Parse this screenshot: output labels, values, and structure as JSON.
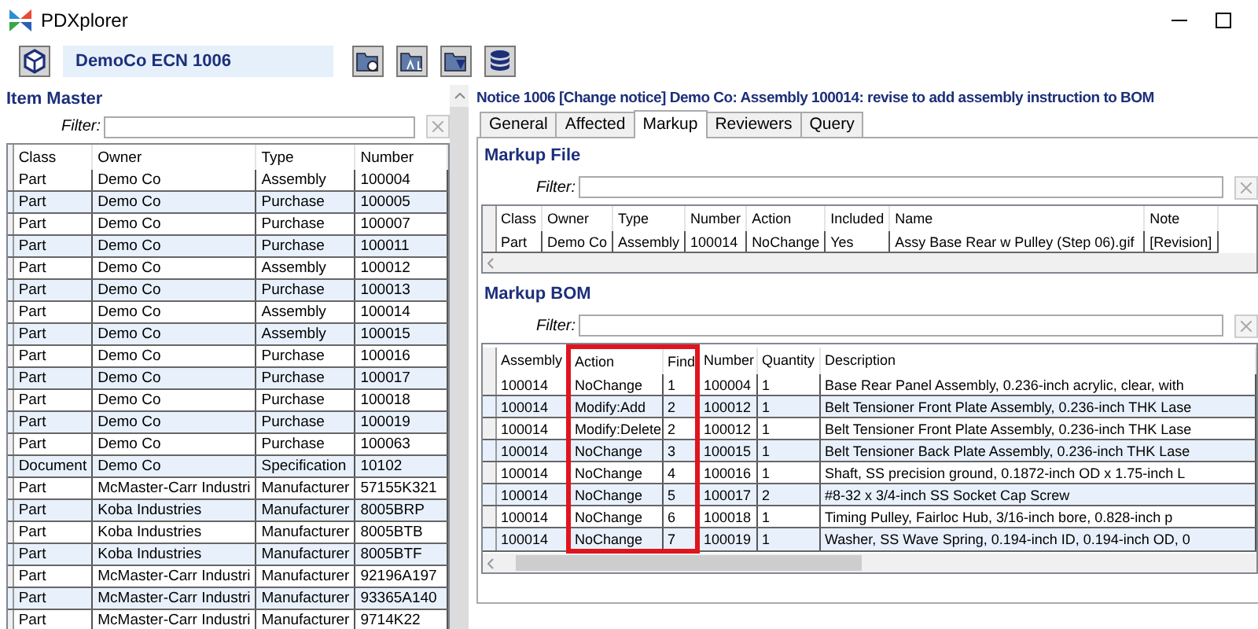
{
  "window": {
    "title": "PDXplorer"
  },
  "toolbar": {
    "context": "DemoCo ECN 1006"
  },
  "item_master": {
    "title": "Item Master",
    "filter": {
      "label": "Filter:"
    },
    "table": {
      "columns": [
        {
          "label": "Class"
        },
        {
          "label": "Owner"
        },
        {
          "label": "Type"
        },
        {
          "label": "Number"
        }
      ],
      "rows": [
        [
          "Part",
          "Demo Co",
          "Assembly",
          "100004"
        ],
        [
          "Part",
          "Demo Co",
          "Purchase",
          "100005"
        ],
        [
          "Part",
          "Demo Co",
          "Purchase",
          "100007"
        ],
        [
          "Part",
          "Demo Co",
          "Purchase",
          "100011"
        ],
        [
          "Part",
          "Demo Co",
          "Assembly",
          "100012"
        ],
        [
          "Part",
          "Demo Co",
          "Purchase",
          "100013"
        ],
        [
          "Part",
          "Demo Co",
          "Assembly",
          "100014"
        ],
        [
          "Part",
          "Demo Co",
          "Assembly",
          "100015"
        ],
        [
          "Part",
          "Demo Co",
          "Purchase",
          "100016"
        ],
        [
          "Part",
          "Demo Co",
          "Purchase",
          "100017"
        ],
        [
          "Part",
          "Demo Co",
          "Purchase",
          "100018"
        ],
        [
          "Part",
          "Demo Co",
          "Purchase",
          "100019"
        ],
        [
          "Part",
          "Demo Co",
          "Purchase",
          "100063"
        ],
        [
          "Document",
          "Demo Co",
          "Specification",
          "10102"
        ],
        [
          "Part",
          "McMaster-Carr Industri",
          "Manufacturer",
          "57155K321"
        ],
        [
          "Part",
          "Koba Industries",
          "Manufacturer",
          "8005BRP"
        ],
        [
          "Part",
          "Koba Industries",
          "Manufacturer",
          "8005BTB"
        ],
        [
          "Part",
          "Koba Industries",
          "Manufacturer",
          "8005BTF"
        ],
        [
          "Part",
          "McMaster-Carr Industri",
          "Manufacturer",
          "92196A197"
        ],
        [
          "Part",
          "McMaster-Carr Industri",
          "Manufacturer",
          "93365A140"
        ],
        [
          "Part",
          "McMaster-Carr Industri",
          "Manufacturer",
          "9714K22"
        ]
      ]
    }
  },
  "notice": {
    "title": "Notice 1006 [Change notice] Demo Co: Assembly 100014: revise to add assembly instruction to BOM",
    "tabs": [
      {
        "label": "General",
        "selected": false
      },
      {
        "label": "Affected",
        "selected": false
      },
      {
        "label": "Markup",
        "selected": true
      },
      {
        "label": "Reviewers",
        "selected": false
      },
      {
        "label": "Query",
        "selected": false
      }
    ],
    "markup_file": {
      "title": "Markup File",
      "filter": {
        "label": "Filter:"
      },
      "table": {
        "columns": [
          {
            "label": "Class"
          },
          {
            "label": "Owner"
          },
          {
            "label": "Type"
          },
          {
            "label": "Number"
          },
          {
            "label": "Action"
          },
          {
            "label": "Included"
          },
          {
            "label": "Name"
          },
          {
            "label": "Note"
          }
        ],
        "rows": [
          [
            "Part",
            "Demo Co",
            "Assembly",
            "100014",
            "NoChange",
            "Yes",
            "Assy Base Rear w Pulley (Step 06).gif",
            "[Revision]"
          ]
        ]
      }
    },
    "markup_bom": {
      "title": "Markup BOM",
      "filter": {
        "label": "Filter:"
      },
      "table": {
        "columns": [
          {
            "label": "Assembly",
            "highlighted": false
          },
          {
            "label": "Action",
            "highlighted": true
          },
          {
            "label": "Find",
            "highlighted": true
          },
          {
            "label": "Number",
            "highlighted": false
          },
          {
            "label": "Quantity",
            "highlighted": false
          },
          {
            "label": "Description",
            "highlighted": false
          }
        ],
        "rows": [
          [
            "100014",
            "NoChange",
            "1",
            "100004",
            "1",
            "Base Rear Panel Assembly, 0.236-inch acrylic, clear, with"
          ],
          [
            "100014",
            "Modify:Add",
            "2",
            "100012",
            "1",
            "Belt Tensioner Front Plate Assembly, 0.236-inch THK Lase"
          ],
          [
            "100014",
            "Modify:Delete",
            "2",
            "100012",
            "1",
            "Belt Tensioner Front Plate Assembly, 0.236-inch THK Lase"
          ],
          [
            "100014",
            "NoChange",
            "3",
            "100015",
            "1",
            "Belt Tensioner Back Plate Assembly, 0.236-inch THK Lase"
          ],
          [
            "100014",
            "NoChange",
            "4",
            "100016",
            "1",
            "Shaft, SS precision ground, 0.1872-inch OD x 1.75-inch L"
          ],
          [
            "100014",
            "NoChange",
            "5",
            "100017",
            "2",
            "#8-32 x 3/4-inch SS Socket Cap Screw"
          ],
          [
            "100014",
            "NoChange",
            "6",
            "100018",
            "1",
            "Timing Pulley, Fairloc Hub,  3/16-inch bore, 0.828-inch p"
          ],
          [
            "100014",
            "NoChange",
            "7",
            "100019",
            "1",
            "Washer, SS Wave Spring, 0.194-inch ID, 0.194-inch OD, 0"
          ]
        ]
      }
    }
  }
}
